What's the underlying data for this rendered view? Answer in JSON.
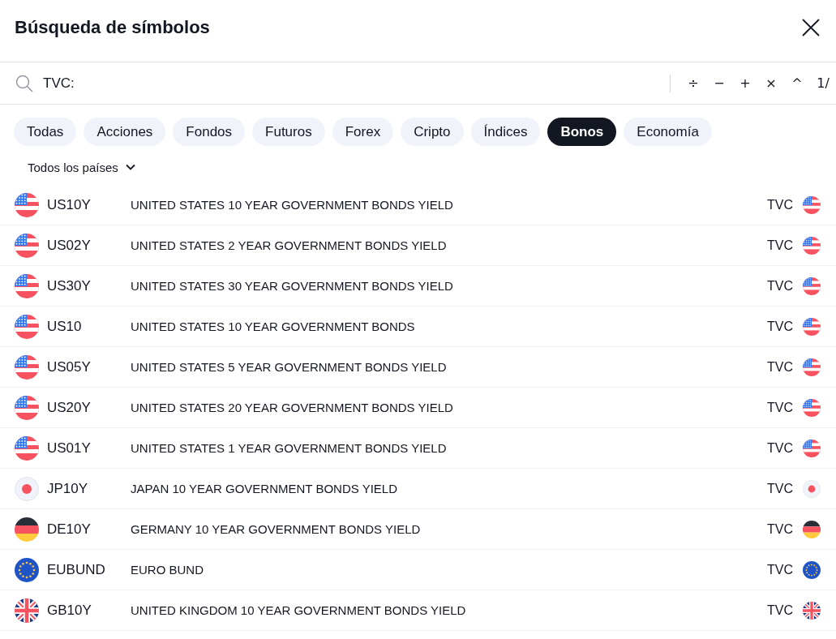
{
  "dialog": {
    "title": "Búsqueda de símbolos"
  },
  "search": {
    "value": "TVC:",
    "keys": [
      "÷",
      "−",
      "+",
      "×",
      "^",
      "1/"
    ]
  },
  "categories": [
    {
      "label": "Todas",
      "selected": false
    },
    {
      "label": "Acciones",
      "selected": false
    },
    {
      "label": "Fondos",
      "selected": false
    },
    {
      "label": "Futuros",
      "selected": false
    },
    {
      "label": "Forex",
      "selected": false
    },
    {
      "label": "Cripto",
      "selected": false
    },
    {
      "label": "Índices",
      "selected": false
    },
    {
      "label": "Bonos",
      "selected": true
    },
    {
      "label": "Economía",
      "selected": false
    }
  ],
  "country_filter": {
    "label": "Todos los países"
  },
  "results": [
    {
      "symbol": "US10Y",
      "description": "UNITED STATES 10 YEAR GOVERNMENT BONDS YIELD",
      "exchange": "TVC",
      "kind": "us"
    },
    {
      "symbol": "US02Y",
      "description": "UNITED STATES 2 YEAR GOVERNMENT BONDS YIELD",
      "exchange": "TVC",
      "kind": "us"
    },
    {
      "symbol": "US30Y",
      "description": "UNITED STATES 30 YEAR GOVERNMENT BONDS YIELD",
      "exchange": "TVC",
      "kind": "us"
    },
    {
      "symbol": "US10",
      "description": "UNITED STATES 10 YEAR GOVERNMENT BONDS",
      "exchange": "TVC",
      "kind": "us"
    },
    {
      "symbol": "US05Y",
      "description": "UNITED STATES 5 YEAR GOVERNMENT BONDS YIELD",
      "exchange": "TVC",
      "kind": "us"
    },
    {
      "symbol": "US20Y",
      "description": "UNITED STATES 20 YEAR GOVERNMENT BONDS YIELD",
      "exchange": "TVC",
      "kind": "us"
    },
    {
      "symbol": "US01Y",
      "description": "UNITED STATES 1 YEAR GOVERNMENT BONDS YIELD",
      "exchange": "TVC",
      "kind": "us"
    },
    {
      "symbol": "JP10Y",
      "description": "JAPAN 10 YEAR GOVERNMENT BONDS YIELD",
      "exchange": "TVC",
      "kind": "jp"
    },
    {
      "symbol": "DE10Y",
      "description": "GERMANY 10 YEAR GOVERNMENT BONDS YIELD",
      "exchange": "TVC",
      "kind": "de"
    },
    {
      "symbol": "EUBUND",
      "description": "EURO BUND",
      "exchange": "TVC",
      "kind": "eu"
    },
    {
      "symbol": "GB10Y",
      "description": "UNITED KINGDOM 10 YEAR GOVERNMENT BONDS YIELD",
      "exchange": "TVC",
      "kind": "gb"
    }
  ]
}
